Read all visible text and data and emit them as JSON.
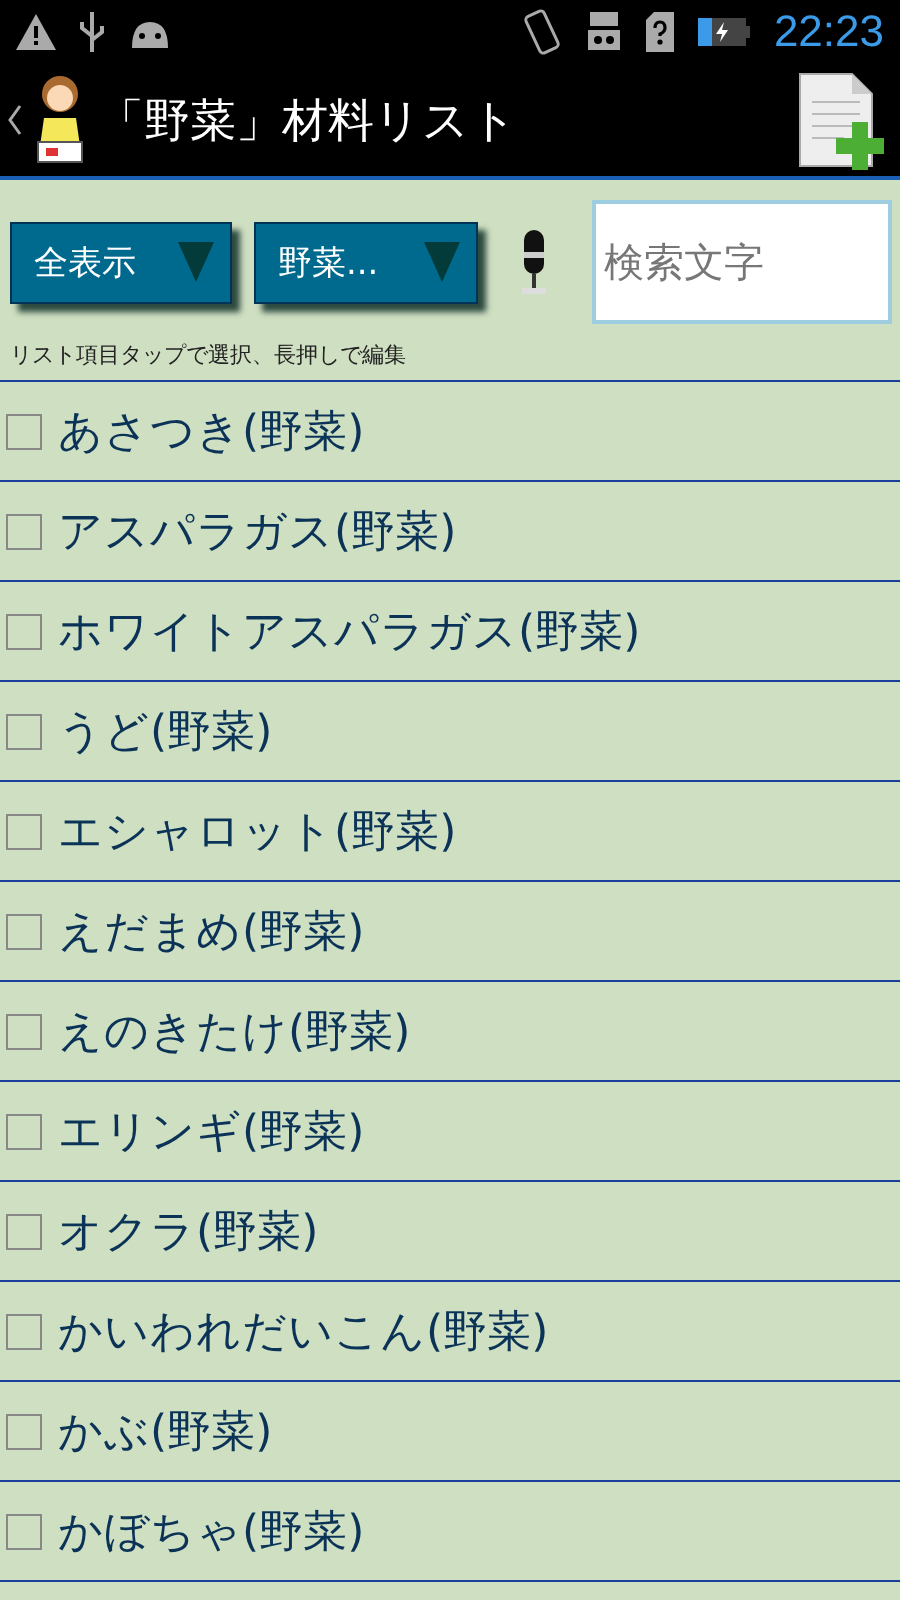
{
  "status_bar": {
    "time": "22:23"
  },
  "header": {
    "title": "「野菜」材料リスト"
  },
  "filters": [
    {
      "label": "全表示"
    },
    {
      "label": "野菜..."
    }
  ],
  "search": {
    "placeholder": "検索文字"
  },
  "hint": "リスト項目タップで選択、長押しで編集",
  "items": [
    {
      "label": "あさつき(野菜)",
      "checked": false
    },
    {
      "label": "アスパラガス(野菜)",
      "checked": false
    },
    {
      "label": "ホワイトアスパラガス(野菜)",
      "checked": false
    },
    {
      "label": "うど(野菜)",
      "checked": false
    },
    {
      "label": "エシャロット(野菜)",
      "checked": false
    },
    {
      "label": "えだまめ(野菜)",
      "checked": false
    },
    {
      "label": "えのきたけ(野菜)",
      "checked": false
    },
    {
      "label": "エリンギ(野菜)",
      "checked": false
    },
    {
      "label": "オクラ(野菜)",
      "checked": false
    },
    {
      "label": "かいわれだいこん(野菜)",
      "checked": false
    },
    {
      "label": "かぶ(野菜)",
      "checked": false
    },
    {
      "label": "かぼちゃ(野菜)",
      "checked": false
    }
  ]
}
